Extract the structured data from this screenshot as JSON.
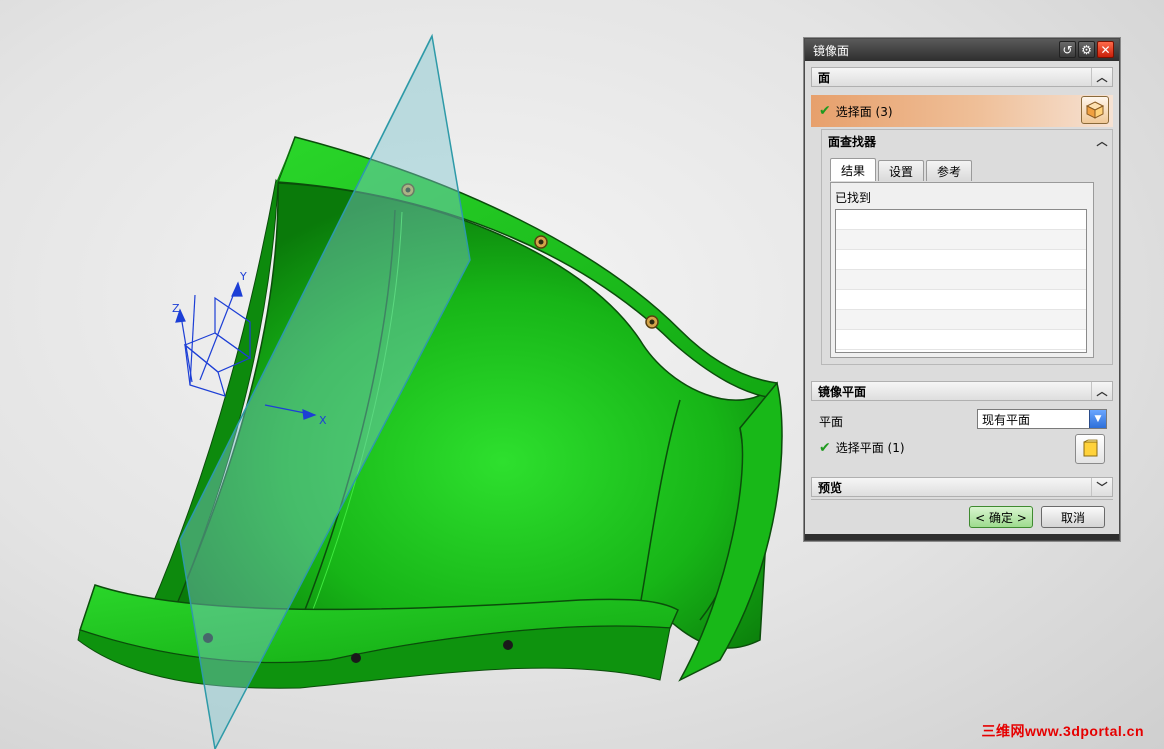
{
  "viewport": {
    "axis_labels": {
      "x": "X",
      "y": "Y",
      "z": "Z"
    },
    "watermark": "三维网www.3dportal.cn",
    "colors": {
      "part_green": "#1fcc1f",
      "plane_fill": "#7fc6cf",
      "axis_blue": "#1d3fd6"
    }
  },
  "dialog": {
    "title": "镜像面",
    "titlebar_icons": [
      "reset-icon",
      "settings-icon",
      "close-icon"
    ],
    "face_section": {
      "header": "面",
      "select_label": "选择面 (3)",
      "face_finder": {
        "header": "面查找器",
        "tabs": [
          {
            "label": "结果"
          },
          {
            "label": "设置"
          },
          {
            "label": "参考"
          }
        ],
        "active_tab": "结果",
        "found_label": "已找到"
      }
    },
    "mirror_plane_section": {
      "header": "镜像平面",
      "plane_label": "平面",
      "plane_value": "现有平面",
      "select_label": "选择平面 (1)"
    },
    "preview_section": {
      "header": "预览"
    },
    "ok_label": "< 确定 >",
    "cancel_label": "取消"
  }
}
